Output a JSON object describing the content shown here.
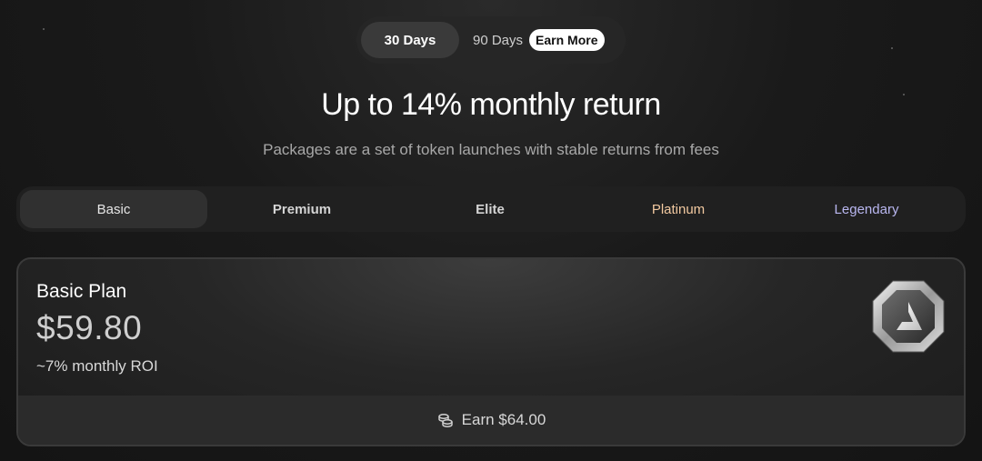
{
  "period_toggle": {
    "active_label": "30 Days",
    "inactive_label": "90 Days",
    "badge_label": "Earn More"
  },
  "headline": {
    "title": "Up to 14% monthly return",
    "subtitle": "Packages are a set of token launches with stable returns from fees"
  },
  "tiers": {
    "items": [
      {
        "label": "Basic",
        "color": "#e6e6e6"
      },
      {
        "label": "Premium",
        "color": "#d4d4d4"
      },
      {
        "label": "Elite",
        "color": "#d4d4d4"
      },
      {
        "label": "Platinum",
        "color": "#f2c9a0"
      },
      {
        "label": "Legendary",
        "color": "#b9b7f0"
      }
    ],
    "active": "Basic"
  },
  "plan": {
    "name": "Basic Plan",
    "price": "$59.80",
    "roi": "~7% monthly ROI",
    "earn_label": "Earn $64.00",
    "logo_icon": "basic-tier-badge-icon",
    "earn_icon": "coins-icon"
  }
}
